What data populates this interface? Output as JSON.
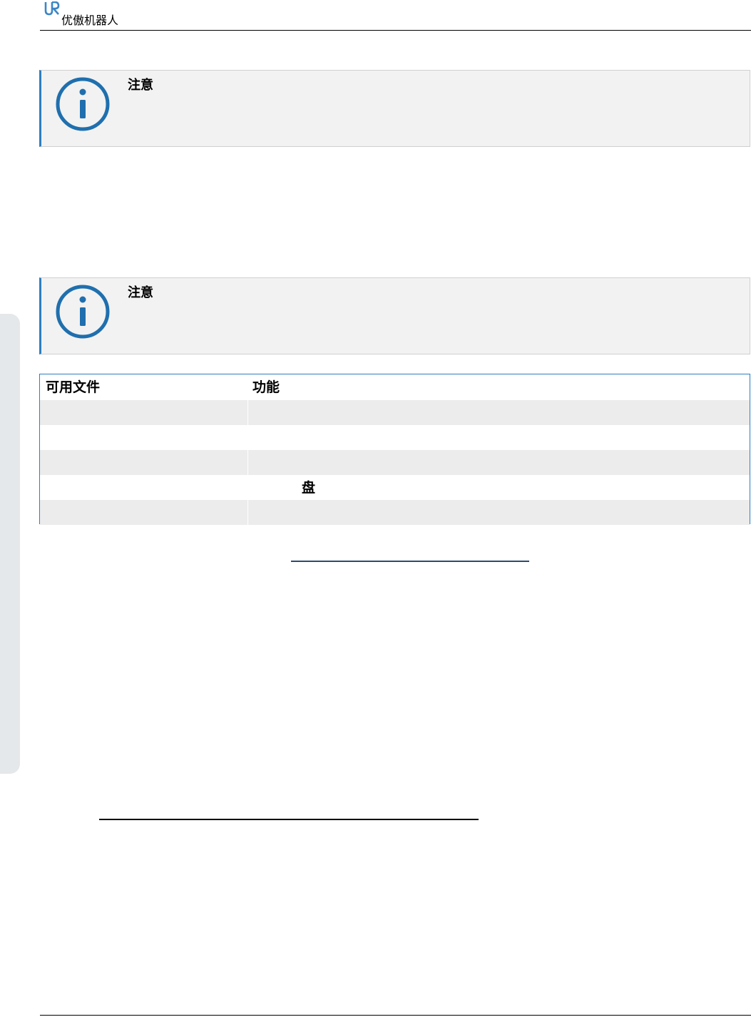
{
  "header": {
    "brand": "优傲机器人",
    "logo_icon": "ur-logo-icon"
  },
  "notes": [
    {
      "title": "注意",
      "icon": "info-icon"
    },
    {
      "title": "注意",
      "icon": "info-icon"
    }
  ],
  "files_table": {
    "headers": [
      "可用文件",
      "功能"
    ],
    "rows": [
      [
        "",
        ""
      ],
      [
        "",
        ""
      ],
      [
        "",
        ""
      ],
      [
        "",
        "盘"
      ],
      [
        "",
        ""
      ]
    ]
  },
  "colors": {
    "accent": "#2d7fc1",
    "note_background": "#f2f2f2",
    "side_tab": "#e5e8ea"
  }
}
